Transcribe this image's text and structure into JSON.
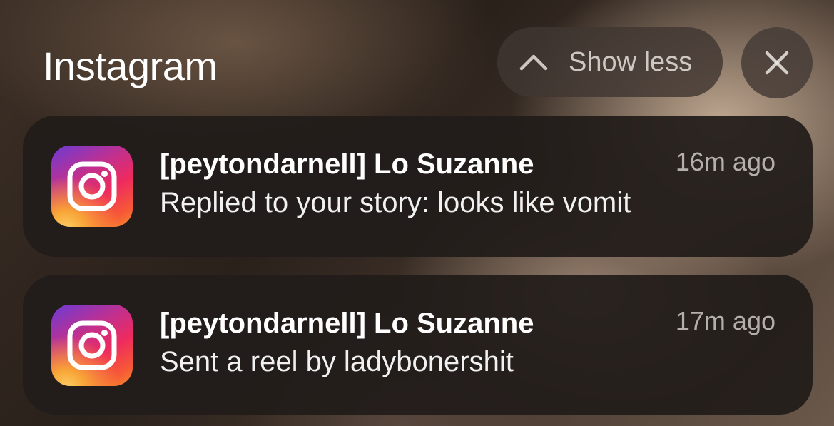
{
  "group": {
    "app_name": "Instagram"
  },
  "controls": {
    "show_less_label": "Show less",
    "close_icon": "close-icon",
    "collapse_icon": "chevron-up-icon"
  },
  "notifications": [
    {
      "app_icon": "instagram-icon",
      "sender": "[peytondarnell] Lo Suzanne",
      "message": "Replied to your story: looks like vomit",
      "time": "16m ago"
    },
    {
      "app_icon": "instagram-icon",
      "sender": "[peytondarnell] Lo Suzanne",
      "message": "Sent a reel by ladybonershit",
      "time": "17m ago"
    }
  ],
  "colors": {
    "card_background": "#211c1a",
    "text_primary": "#ffffff",
    "text_secondary": "#ebe6e1"
  }
}
